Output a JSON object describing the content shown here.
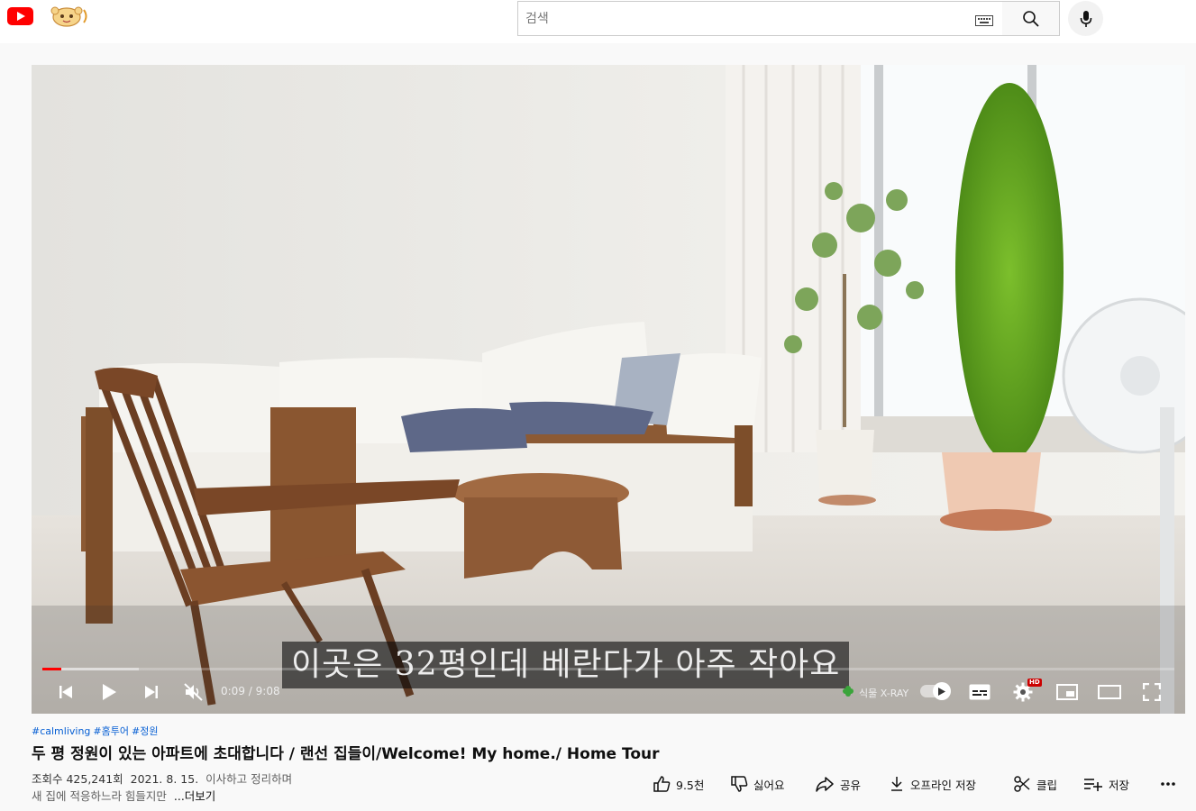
{
  "header": {
    "search_placeholder": "검색"
  },
  "player": {
    "subtitle": "이곳은 32평인데 베란다가 아주 작아요",
    "time_current": "0:09",
    "time_separator": "/",
    "time_total": "9:08",
    "progress_fraction": 0.017,
    "buffered_fraction": 0.085,
    "xray_label": "식물 X-RAY",
    "quality_badge": "HD"
  },
  "video": {
    "hashtags": [
      "#calmliving",
      "#홈투어",
      "#정원"
    ],
    "title": "두 평 정원이 있는 아파트에 초대합니다 / 랜선 집들이/Welcome! My home./ Home Tour",
    "views": "조회수 425,241회",
    "date": "2021. 8. 15.",
    "desc_line1": "이사하고 정리하며",
    "desc_line2": "새 집에 적응하느라 힘들지만",
    "more": "...더보기"
  },
  "actions": {
    "like": "9.5천",
    "dislike": "싫어요",
    "share": "공유",
    "download": "오프라인 저장",
    "clip": "클립",
    "save": "저장"
  },
  "colors": {
    "brand_red": "#ff0000",
    "link_blue": "#065fd4"
  }
}
